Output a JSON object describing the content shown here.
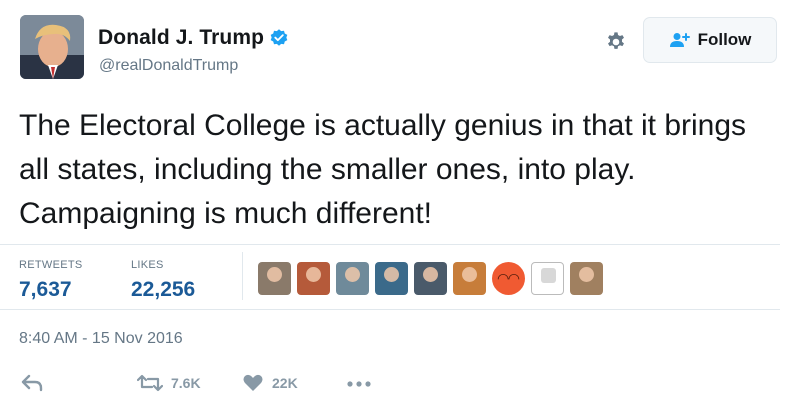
{
  "author": {
    "name": "Donald J. Trump",
    "handle": "@realDonaldTrump",
    "verified": true
  },
  "follow_button": {
    "label": "Follow",
    "icon": "add-user-icon"
  },
  "settings_icon": "gear-icon",
  "tweet": {
    "text": "The Electoral College is actually genius in that it brings all states, including the smaller ones, into play. Campaigning is much different!"
  },
  "stats": {
    "retweets_label": "RETWEETS",
    "retweets_value": "7,637",
    "likes_label": "LIKES",
    "likes_value": "22,256"
  },
  "likers": [
    {
      "color": "#8a7a6a"
    },
    {
      "color": "#b55a3a"
    },
    {
      "color": "#6f8a9a"
    },
    {
      "color": "#3b6a8a"
    },
    {
      "color": "#4a5a6a"
    },
    {
      "color": "#c77d3a"
    },
    {
      "color": "#f05a32",
      "kind": "emoji"
    },
    {
      "color": "#ffffff",
      "kind": "cartoon"
    },
    {
      "color": "#a08060"
    }
  ],
  "timestamp": "8:40 AM - 15 Nov 2016",
  "actions": {
    "reply_icon": "reply-icon",
    "retweet_icon": "retweet-icon",
    "retweet_count": "7.6K",
    "like_icon": "heart-icon",
    "like_count": "22K",
    "more_icon": "more-dots-icon"
  },
  "colors": {
    "verified_blue": "#1da1f2",
    "stat_blue": "#1b5a97",
    "muted": "#657786",
    "border": "#e1e8ed"
  }
}
